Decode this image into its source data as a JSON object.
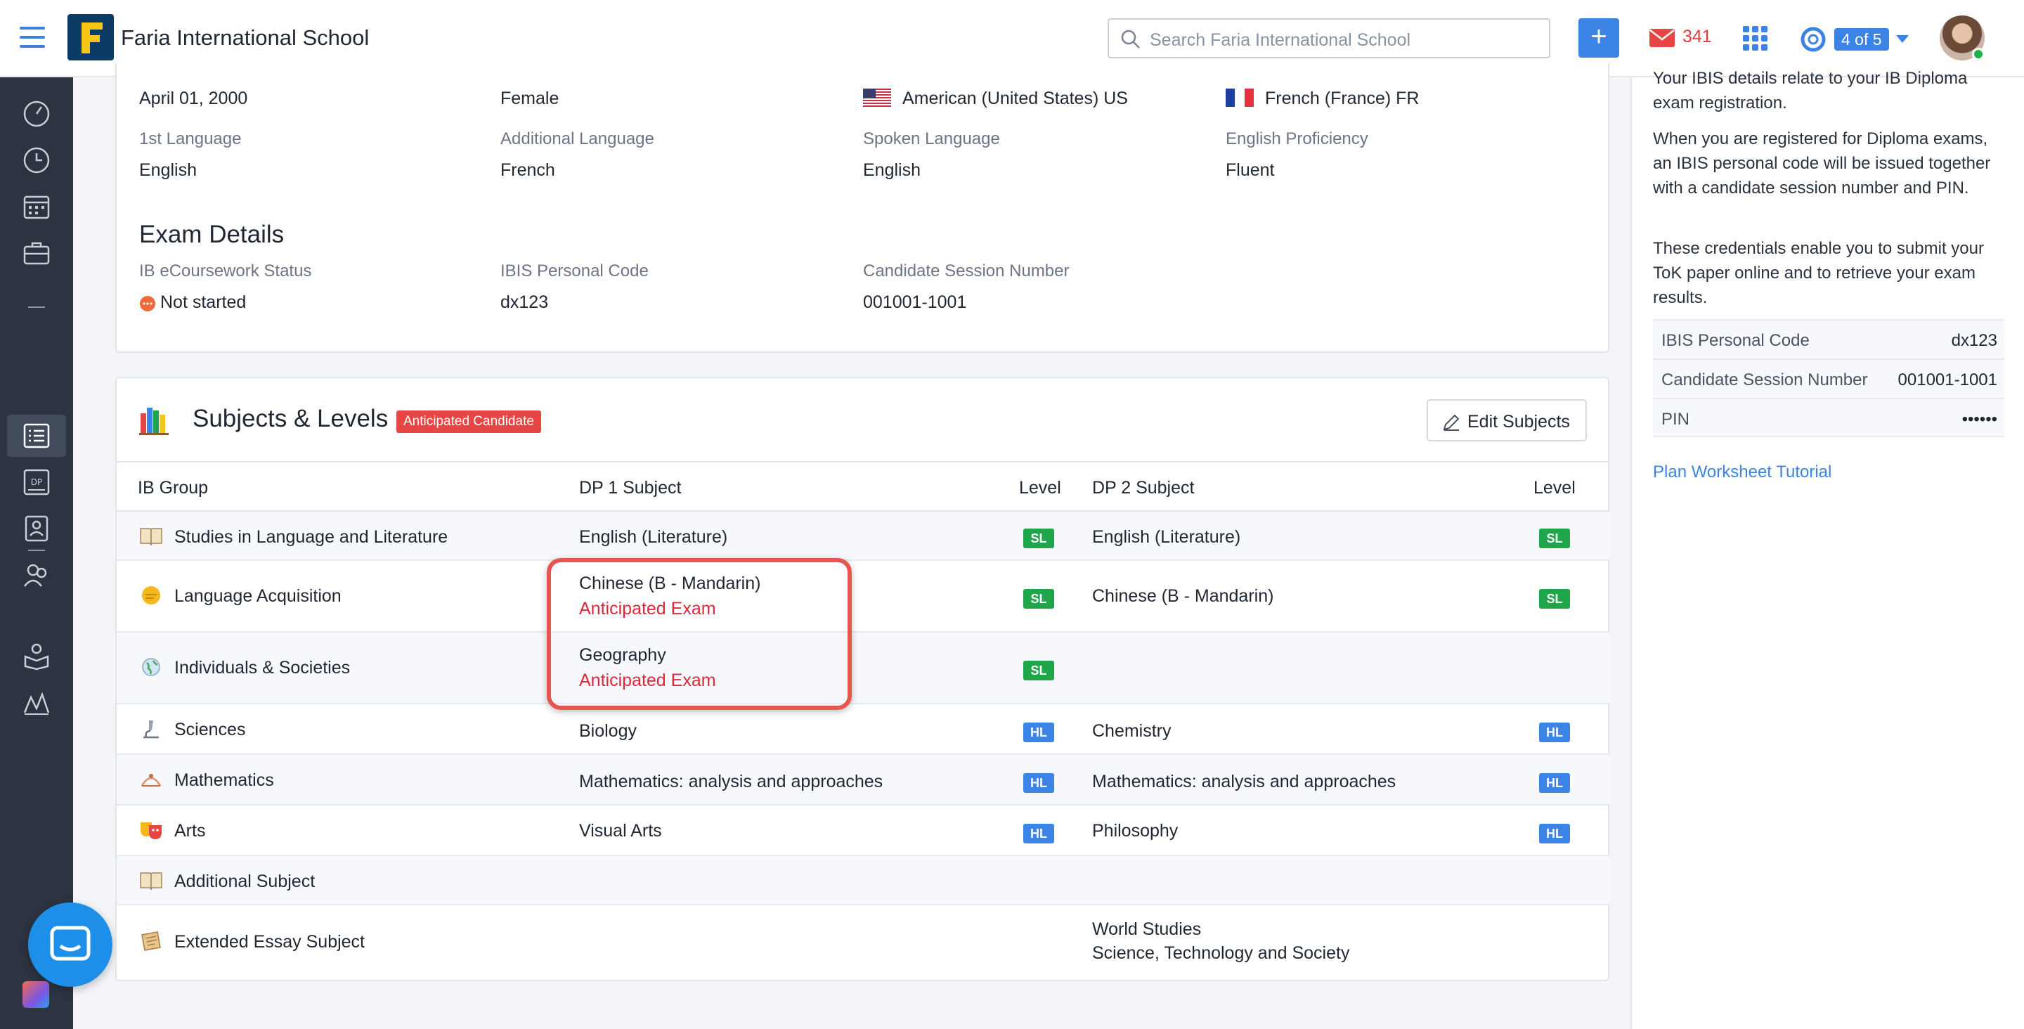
{
  "app": {
    "school_name": "Faria International School",
    "search_placeholder": "Search Faria International School",
    "mail_count": "341",
    "pager": "4 of 5"
  },
  "profile": {
    "row1": {
      "dob": "April 01, 2000",
      "gender": "Female",
      "nationality": "American (United States) US",
      "second_nationality": "French (France) FR"
    },
    "labels": {
      "first_language": "1st Language",
      "additional_language": "Additional Language",
      "spoken_language": "Spoken Language",
      "english_proficiency": "English Proficiency"
    },
    "values": {
      "first_language": "English",
      "additional_language": "French",
      "spoken_language": "English",
      "english_proficiency": "Fluent"
    }
  },
  "exam_details": {
    "title": "Exam Details",
    "labels": {
      "ecoursework": "IB eCoursework Status",
      "ibis_code": "IBIS Personal Code",
      "session_number": "Candidate Session Number"
    },
    "values": {
      "ecoursework": "Not started",
      "ibis_code": "dx123",
      "session_number": "001001-1001"
    }
  },
  "subjects": {
    "title": "Subjects & Levels",
    "badge": "Anticipated Candidate",
    "edit_label": "Edit Subjects",
    "columns": {
      "group": "IB Group",
      "dp1": "DP 1 Subject",
      "level1": "Level",
      "dp2": "DP 2 Subject",
      "level2": "Level"
    },
    "rows": [
      {
        "group": "Studies in Language and Literature",
        "dp1": "English (Literature)",
        "dp1_note": "",
        "l1": "SL",
        "dp2": "English (Literature)",
        "dp2_line2": "",
        "l2": "SL"
      },
      {
        "group": "Language Acquisition",
        "dp1": "Chinese (B - Mandarin)",
        "dp1_note": "Anticipated Exam",
        "l1": "SL",
        "dp2": "Chinese (B - Mandarin)",
        "dp2_line2": "",
        "l2": "SL"
      },
      {
        "group": "Individuals & Societies",
        "dp1": "Geography",
        "dp1_note": "Anticipated Exam",
        "l1": "SL",
        "dp2": "",
        "dp2_line2": "",
        "l2": ""
      },
      {
        "group": "Sciences",
        "dp1": "Biology",
        "dp1_note": "",
        "l1": "HL",
        "dp2": "Chemistry",
        "dp2_line2": "",
        "l2": "HL"
      },
      {
        "group": "Mathematics",
        "dp1": "Mathematics: analysis and approaches",
        "dp1_note": "",
        "l1": "HL",
        "dp2": "Mathematics: analysis and approaches",
        "dp2_line2": "",
        "l2": "HL"
      },
      {
        "group": "Arts",
        "dp1": "Visual Arts",
        "dp1_note": "",
        "l1": "HL",
        "dp2": "Philosophy",
        "dp2_line2": "",
        "l2": "HL"
      },
      {
        "group": "Additional Subject",
        "dp1": "",
        "dp1_note": "",
        "l1": "",
        "dp2": "",
        "dp2_line2": "",
        "l2": ""
      },
      {
        "group": "Extended Essay Subject",
        "dp1": "",
        "dp1_note": "",
        "l1": "",
        "dp2": "World Studies",
        "dp2_line2": "Science, Technology and Society",
        "l2": ""
      }
    ]
  },
  "side_panel": {
    "para1": "Your IBIS details relate to your IB Diploma exam registration.",
    "para2": "When you are registered for Diploma exams, an IBIS personal code will be issued together with a candidate session number and PIN.",
    "para3": "These credentials enable you to submit your ToK paper online and to retrieve your exam results.",
    "rows": [
      {
        "key": "IBIS Personal Code",
        "value": "dx123"
      },
      {
        "key": "Candidate Session Number",
        "value": "001001-1001"
      },
      {
        "key": "PIN",
        "value": "••••••"
      }
    ],
    "link": "Plan Worksheet Tutorial"
  },
  "colors": {
    "accent": "#3b84e6",
    "danger": "#e0273a",
    "sl": "#1fa64a",
    "hl": "#3b84e6"
  }
}
